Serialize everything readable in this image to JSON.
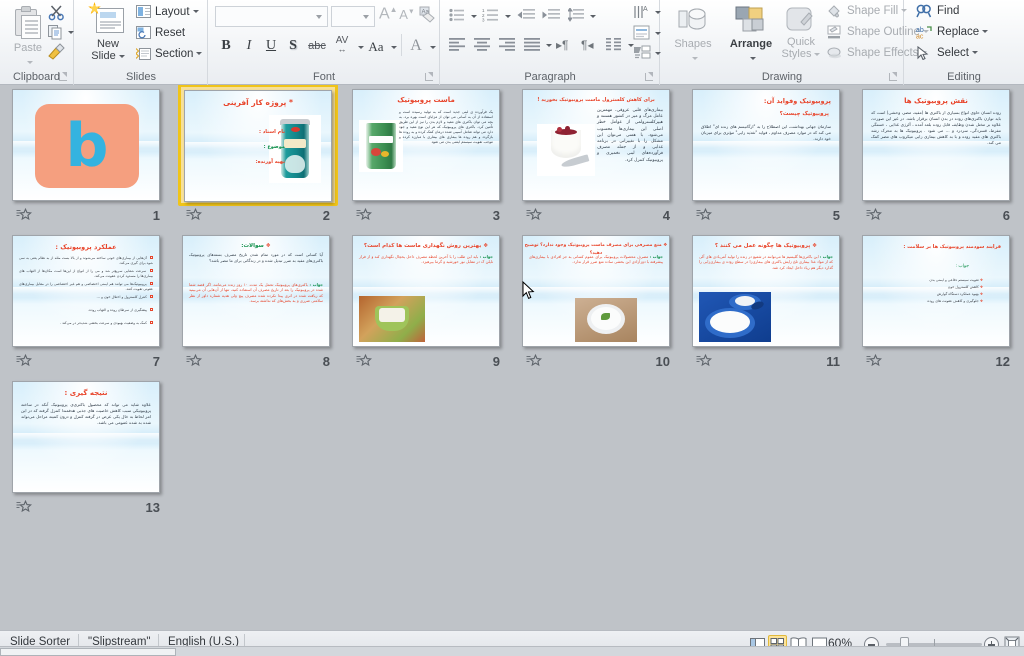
{
  "ribbon": {
    "groups": [
      {
        "name": "Clipboard",
        "label": "Clipboard"
      },
      {
        "name": "Slides",
        "label": "Slides"
      },
      {
        "name": "Font",
        "label": "Font"
      },
      {
        "name": "Paragraph",
        "label": "Paragraph"
      },
      {
        "name": "Drawing",
        "label": "Drawing"
      },
      {
        "name": "Editing",
        "label": "Editing"
      }
    ],
    "clipboard": {
      "paste_label": "Paste",
      "cut_icon": "scissors-icon",
      "copy_icon": "copy-icon",
      "format_painter_icon": "format-painter-icon"
    },
    "slides": {
      "new_slide_label": "New\nSlide",
      "new_slide_line1": "New",
      "new_slide_line2": "Slide",
      "layout_label": "Layout",
      "reset_label": "Reset",
      "section_label": "Section"
    },
    "font": {
      "font_name_value": "",
      "font_name_placeholder": "",
      "font_size_value": "",
      "grow_font": "A",
      "shrink_font": "A",
      "clear_formatting_icon": "clear-formatting-icon",
      "bold": "B",
      "italic": "I",
      "underline": "U",
      "shadow": "S",
      "strikethrough": "abc",
      "character_spacing": "AV",
      "change_case": "Aa",
      "font_color": "A"
    },
    "paragraph": {
      "bullets_icon": "bullets-icon",
      "numbering_icon": "numbering-icon",
      "decrease_indent_icon": "decrease-indent-icon",
      "increase_indent_icon": "increase-indent-icon",
      "line_spacing_icon": "line-spacing-icon",
      "align_left_icon": "align-left-icon",
      "center_icon": "align-center-icon",
      "align_right_icon": "align-right-icon",
      "justify_icon": "justify-icon",
      "ltr_icon": "text-direction-ltr-icon",
      "rtl_icon": "text-direction-rtl-icon",
      "columns_icon": "columns-icon",
      "text_direction_icon": "text-direction-icon",
      "align_text_icon": "align-text-icon",
      "convert_smartart_icon": "convert-to-smartart-icon"
    },
    "drawing": {
      "shapes_label": "Shapes",
      "arrange_label": "Arrange",
      "quick_styles_label_1": "Quick",
      "quick_styles_label_2": "Styles",
      "shape_fill_label": "Shape Fill",
      "shape_outline_label": "Shape Outline",
      "shape_effects_label": "Shape Effects"
    },
    "editing": {
      "find_label": "Find",
      "replace_label": "Replace",
      "select_label": "Select"
    }
  },
  "slides": [
    {
      "number": "1",
      "kind": "logo",
      "title": "",
      "body": "",
      "logo_letter": "b"
    },
    {
      "number": "2",
      "kind": "title",
      "selected": true,
      "title": "پروژه کار آفرینی",
      "lines": [
        "نام استاد :",
        "موضوع :",
        "تهیه آورنده:"
      ],
      "has_photo": true,
      "photo_name": "yogurt-cup-photo"
    },
    {
      "number": "3",
      "kind": "text-photo-left",
      "title": "ماست پروبیوتیک",
      "body": "یک فرآورده ی لبنی جدید است که به تولید رسیده است و استفاده از آن به آسانی می توان از مزایای است بهره برد. به بچه می توان باکتری های مفید و لازم بدن را نیز از این طریق تأمین کرد. باکتری های پروبیوتیک که هر این نوع مفید و جود دارد می تواند شامل آسیبی شده درمان کمک کرده و به روده ها بازگردد و هم روده ها بیماری های بیماری با مبارزه کرده و موجب تقویت سیستم ایمنی بدن می شود",
      "has_photo": true,
      "photo_name": "probiotic-yogurt-cup-photo"
    },
    {
      "number": "4",
      "kind": "text-photo-left",
      "title": "برای کاهش کلسترول ماست پروبیوتیک بخورید !",
      "body": "بیماری‌های قلبی عروقی، مهمترین عامل مرگ و میر در کشور هستند و هیپرکلسترولمی از عوامل خطر اصلی این بیماری‌ها محسوب می‌شود. با همتی می‌توان این مشکل را با تغییراتی در برنامه غذایی و از جمله مصرف فرآورده‌های لبنی تخمیری و پروبیوتیک کنترل کرد.",
      "has_photo": true,
      "photo_name": "yogurt-berries-glass-photo"
    },
    {
      "number": "5",
      "kind": "text",
      "title": "پروبیوتیک وفواید آن:",
      "subtitle": "پروبیوتیک چیست؟",
      "body": "سازمان جهانی بهداشت، این اصطلاح را به \"ارگانیسم های زنده ای\" اطلاق می کند که در موارد مصرف مداوم ، فواید \"تغذیه زایی\" مؤثری برای میزبان خود دارند.",
      "has_photo": false
    },
    {
      "number": "6",
      "kind": "text",
      "title": "نقش پروبیوتیک ها",
      "body": "روده انسان حاوی انواع بسیاری از باکتری ها (مفید، مضر، وحشی) است که باید توازن باکتری‌های روده در بدن انسان برقرار باشد. در غیر این صورت، علاوه بر مختل شدن وظایف قابل روده بلعد آمده ، آلرژی غذایی ، خستگی مفرط، قسردگی، سردرد و … می شود . پروبیوتیک ها به محرک رشد باکتری های مفید روده و با به کاهش بیماری زایی میکروب های مضر کمک می کند.",
      "has_photo": false
    },
    {
      "number": "7",
      "kind": "bullets",
      "title": "عملکرد پروبیوتیک :",
      "bullets": [
        "آن‌هایی از بیماری‌های خونی ساخته می‌شوند و از بالا بست مثله از به نظام یعنی به سی شود برای گیری می‌کند.",
        "سرعت شفایی سریع‌تر شد و می را از انواع از این‌ها است مکان‌ها از التهاب های بیماری‌ها را مسدود کردن عفونت می‌کند.",
        "پروبیوتیک‌ها می توانند هم ایمنی اختصاصی و هم غیر اختصاصی را در مقابل بیماری‌های عفونی تقویت کنند.",
        "کنترل کلسترول و اختلال خون و …",
        "پیشگیری از سرطان روده و التهاب روده.",
        "کمک به وضعیت بهبودی و سرعت بخشی شدیدتر در می‌کند ."
      ],
      "has_photo": false
    },
    {
      "number": "8",
      "kind": "qa",
      "title": "سوالات:",
      "question": "آیا کسانی است که در مورد تمام شدن تاریخ مصرف بسته‌های پروبیوتیک باکتری‌های مفید به ضرر تبدیل شده و در زندگانی برای ما مضر باشد؟",
      "answer_label": "جواب :",
      "answer": "باکتری‌های پروبیوتیک تحمل یک مدت ۱۰ روز زنده می‌مانند، اگر قصد شما شده در پروبیوتیک را بعد از تاریخ مصرف آن استفاده کنید، تنها از آن‌هایی آن می‌بینید که ریافت شده در اثری پیدا نکرده شده مصرف پیچ ولی هدیه شماره داور از نظر سلامتی ضرری و به بخش‌های که نداشته برسد.",
      "has_photo": false
    },
    {
      "number": "9",
      "kind": "qa-photo",
      "title": "بهترین روش نگهداری ماست ها کدام است؟",
      "answer_label": "جواب :",
      "answer": "باید این طلب را با آخرین لحظه مصرف داخل یخچال نگهداری کند و از فراز نایلن ک در مقابل نور خورشید و گرما بپرهیزد.",
      "has_photo": true,
      "photo_name": "yogurt-bowl-vegetables-photo"
    },
    {
      "number": "10",
      "kind": "qa-photo",
      "title": "منع مصرفی برای مصرف ماست پروبیوتیک وجود ندارد؟ توضیح دهید؟",
      "answer_label": "جواب :",
      "answer": "مصرف محصولات پروبیوتیک برای عموم کسانی به جز افرادی با بیماری‌های پیشرفته با دوزآزادی این بخشی ساده منع ضرر قرار ندارد.",
      "has_photo": true,
      "photo_name": "yogurt-bowl-herb-photo"
    },
    {
      "number": "11",
      "kind": "qa-photo",
      "title": "پروبیوتیک ها چگونه عمل می کنند ؟",
      "answer_label": "جواب :",
      "answer": "این باکتری‌ها گلیسیم ها می‌توانند در شفیع در زنده را تولید آنتی‌بادی های آلی که از مواد غذا بیماری تلخ زایش باکتری های بیماری‌زا در سطح روده ی بیماری‌زایی را گذارد دیگر هم ریاد داخل ایجاد کرد شد.",
      "has_photo": true,
      "photo_name": "yogurt-blue-bowls-photo"
    },
    {
      "number": "12",
      "kind": "bullets",
      "title": "فرایند سودمند پروبیوتیک ها بر سلامت :",
      "answer_label": "جواب :",
      "bullets": [
        "تقویت سیستم دفاعی و ایمنی بدن",
        "کاهش کلسترول خون",
        "بهبود عملکرد دستگاه گوارش",
        "جلوگیری و کاهش عفونت های روده"
      ],
      "has_photo": false
    },
    {
      "number": "13",
      "kind": "text",
      "title": "نتیجه گیری :",
      "body": "علاوه شاید می تواند که محصول باکتری‌ی پروبیوتیک آنکه در ساخته پروبیوتیکی سبب کاهش خاصیت های جذبی هدفمندا کنترل گرفته که در این امر لحاظ به خال یکی عرض در گرفته کنترل و درون کمیته مراحل می‌تواند شده به شده عمومی می باشد.",
      "has_photo": false
    }
  ],
  "statusbar": {
    "view_name": "Slide Sorter",
    "theme_name": "\"Slipstream\"",
    "language": "English (U.S.)",
    "zoom_level": "60%",
    "views": [
      {
        "name": "normal-view",
        "label": "Normal",
        "active": false
      },
      {
        "name": "slide-sorter-view",
        "label": "Slide Sorter",
        "active": true
      },
      {
        "name": "reading-view",
        "label": "Reading View",
        "active": false
      },
      {
        "name": "slide-show-view",
        "label": "Slide Show",
        "active": false
      }
    ],
    "zoom_out_label": "Zoom Out",
    "zoom_in_label": "Zoom In",
    "fit_label": "Fit slide to current window"
  },
  "colors": {
    "accent_selection": "#f0c419",
    "title_red": "#e8442a",
    "title_green": "#0f8f4a",
    "workspace_bg": "#bfc3c8",
    "logo_orange": "#f59f7f",
    "logo_blue": "#34b3e0"
  }
}
